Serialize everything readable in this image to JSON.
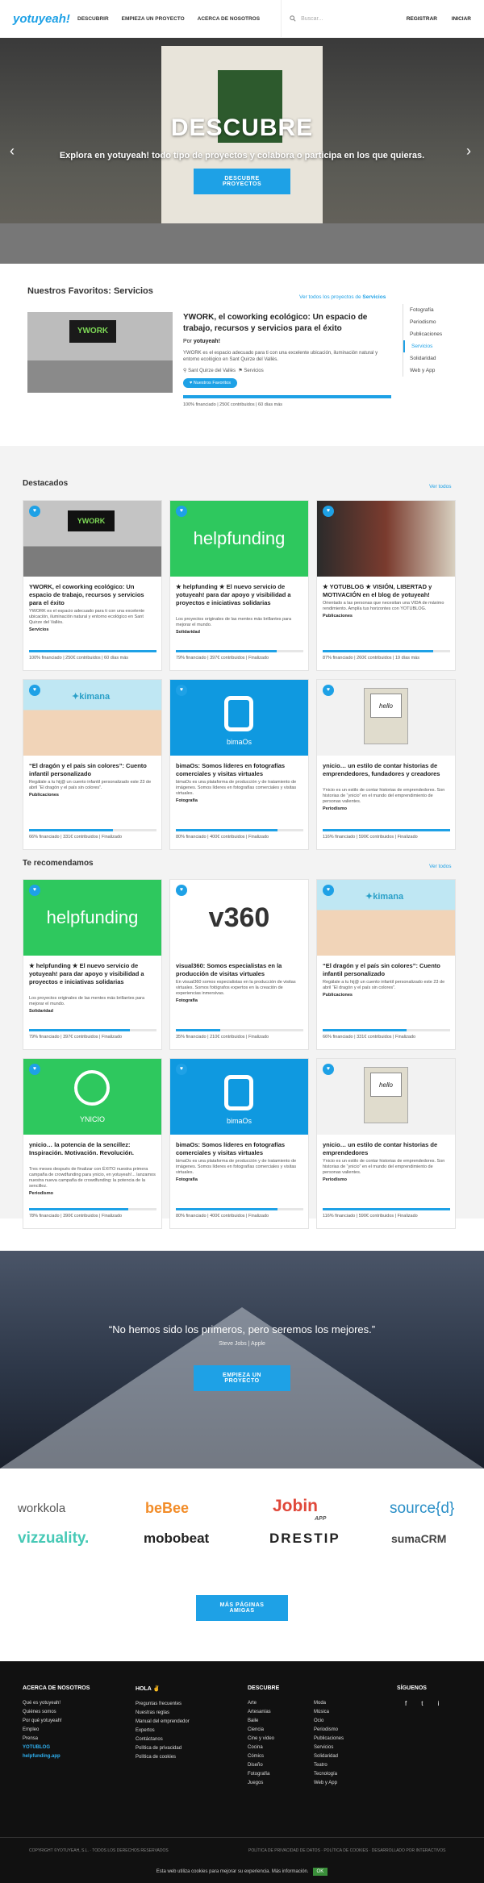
{
  "nav": {
    "logo": "yotuyeah!",
    "links": [
      "DESCUBRIR",
      "EMPIEZA UN PROYECTO",
      "ACERCA DE NOSOTROS"
    ],
    "search_placeholder": "Buscar...",
    "register": "REGISTRAR",
    "login": "INICIAR"
  },
  "hero": {
    "title": "DESCUBRE",
    "subtitle": "Explora en yotuyeah! todo tipo de proyectos y colabora o participa en los que quieras.",
    "button": "DESCUBRE PROYECTOS"
  },
  "favorites": {
    "heading": "Nuestros Favoritos: Servicios",
    "see_all_prefix": "Ver todos los proyectos de ",
    "see_all_cat": "Servicios",
    "title": "YWORK, el coworking ecológico: Un espacio de trabajo, recursos y servicios para el éxito",
    "by": "Por ",
    "author": "yotuyeah!",
    "desc": "YWORK es el espacio adecuado para ti con una excelente ubicación, iluminación natural y entorno ecológico en Sant Quirze del Vallès.",
    "location": "Sant Quirze del Vallès",
    "category": "Servicios",
    "badge": "Nuestros Favoritos",
    "stats": "100% financiado | 250€ contribuidos | 60 días más",
    "progress": 100,
    "side": [
      "Fotografía",
      "Periodismo",
      "Publicaciones",
      "Servicios",
      "Solidaridad",
      "Web y App"
    ]
  },
  "highlighted": {
    "title": "Destacados",
    "see_all": "Ver todos",
    "cards": [
      {
        "title": "YWORK, el coworking ecológico: Un espacio de trabajo, recursos y servicios para el éxito",
        "desc": "YWORK es el espacio adecuado para ti con una excelente ubicación, iluminación natural y entorno ecológico en Sant Quirze del Vallès.",
        "cat": "Servicios",
        "stats": "100% financiado | 250€ contribuidos | 60 días más",
        "progress": 100,
        "img": "ywork"
      },
      {
        "title": "★ helpfunding ★ El nuevo servicio de yotuyeah! para dar apoyo y visibilidad a proyectos e iniciativas solidarias",
        "desc": "Los proyectos originales de las mentes más brillantes para mejorar el mundo.",
        "cat": "Solidaridad",
        "stats": "79% financiado | 397€ contribuidos | Finalizado",
        "progress": 79,
        "img": "helpfunding"
      },
      {
        "title": "★ YOTUBLOG ★ VISIÓN, LIBERTAD y MOTIVACIÓN en el blog de yotuyeah!",
        "desc": "Orientado a las personas que necesitan una VIDA de máximo rendimiento. Amplía tus horizontes con YOTUBLOG.",
        "cat": "Publicaciones",
        "stats": "87% financiado | 260€ contribuidos | 19 días más",
        "progress": 87,
        "img": "mag"
      },
      {
        "title": "“El dragón y el país sin colores”: Cuento infantil personalizado",
        "desc": "Regálale a tu hij@ un cuento infantil personalizado este 23 de abril “El dragón y el país sin colores”.",
        "cat": "Publicaciones",
        "stats": "66% financiado | 331€ contribuidos | Finalizado",
        "progress": 66,
        "img": "kimana"
      },
      {
        "title": "bimaOs: Somos líderes en fotografías comerciales y visitas virtuales",
        "desc": "bimaOs es una plataforma de producción y de tratamiento de imágenes. Somos líderes en fotografías comerciales y visitas virtuales.",
        "cat": "Fotografía",
        "stats": "80% financiado | 400€ contribuidos | Finalizado",
        "progress": 80,
        "img": "bimaos"
      },
      {
        "title": "ynicio… un estilo de contar historias de emprendedores, fundadores y creadores",
        "desc": "Ynicio es un estilo de contar historias de emprendedores. Son historias de “ynicio” en el mundo del emprendimiento de personas valientes.",
        "cat": "Periodismo",
        "stats": "116% financiado | 590€ contribuidos | Finalizado",
        "progress": 100,
        "img": "mac"
      }
    ]
  },
  "recommended": {
    "title": "Te recomendamos",
    "see_all": "Ver todos",
    "cards": [
      {
        "title": "★ helpfunding ★ El nuevo servicio de yotuyeah! para dar apoyo y visibilidad a proyectos e iniciativas solidarias",
        "desc": "Los proyectos originales de las mentes más brillantes para mejorar el mundo.",
        "cat": "Solidaridad",
        "stats": "79% financiado | 397€ contribuidos | Finalizado",
        "progress": 79,
        "img": "helpfunding"
      },
      {
        "title": "visual360: Somos especialistas en la producción de visitas virtuales",
        "desc": "En visual360 somos especialistas en la producción de visitas virtuales. Somos fotógrafos expertos en la creación de experiencias inmersivas.",
        "cat": "Fotografía",
        "stats": "35% financiado | 210€ contribuidos | Finalizado",
        "progress": 35,
        "img": "v360"
      },
      {
        "title": "“El dragón y el país sin colores”: Cuento infantil personalizado",
        "desc": "Regálale a tu hij@ un cuento infantil personalizado este 23 de abril “El dragón y el país sin colores”.",
        "cat": "Publicaciones",
        "stats": "66% financiado | 331€ contribuidos | Finalizado",
        "progress": 66,
        "img": "kimana"
      },
      {
        "title": "ynicio… la potencia de la sencillez: Inspiración. Motivación. Revolución.",
        "desc": "Tres meses después de finalizar con ÉXITO nuestra primera campaña de crowdfunding para ynicio, en yotuyeah!... lanzamos nuestra nueva campaña de crowdfunding: la potencia de la sencillez.",
        "cat": "Periodismo",
        "stats": "78% financiado | 390€ contribuidos | Finalizado",
        "progress": 78,
        "img": "ynicio"
      },
      {
        "title": "bimaOs: Somos líderes en fotografías comerciales y visitas virtuales",
        "desc": "bimaOs es una plataforma de producción y de tratamiento de imágenes. Somos líderes en fotografías comerciales y visitas virtuales.",
        "cat": "Fotografía",
        "stats": "80% financiado | 400€ contribuidos | Finalizado",
        "progress": 80,
        "img": "bimaos"
      },
      {
        "title": "ynicio… un estilo de contar historias de emprendedores",
        "desc": "Ynicio es un estilo de contar historias de emprendedores. Son historias de “ynicio” en el mundo del emprendimiento de personas valientes.",
        "cat": "Periodismo",
        "stats": "116% financiado | 590€ contribuidos | Finalizado",
        "progress": 100,
        "img": "mac"
      }
    ]
  },
  "quote": {
    "text": "“No hemos sido los primeros, pero seremos los mejores.”",
    "author": "Steve Jobs | Apple",
    "button": "EMPIEZA UN PROYECTO"
  },
  "brands": [
    "workkola",
    "beBee",
    "Jobin",
    "source{d}",
    "vizzuality.",
    "mobobeat",
    "DRESTIP",
    "sumaCRM"
  ],
  "brand_sub": "APP",
  "more_button": "MÁS PÁGINAS AMIGAS",
  "footer": {
    "about": {
      "title": "ACERCA DE NOSOTROS",
      "items": [
        "Qué es yotuyeah!",
        "Quiénes somos",
        "Por qué yotuyeah!",
        "Empleo",
        "Prensa",
        "YOTUBLOG",
        "helpfunding.app"
      ]
    },
    "hola": {
      "title": "HOLA ✌",
      "items": [
        "Preguntas frecuentes",
        "Nuestras reglas",
        "Manual del emprendedor",
        "Expertos",
        "Contáctanos",
        "Política de privacidad",
        "Política de cookies"
      ]
    },
    "discover": {
      "title": "DESCUBRE",
      "col1": [
        "Arte",
        "Artesanías",
        "Baile",
        "Ciencia",
        "Cine y video",
        "Cocina",
        "Cómics",
        "Diseño",
        "Fotografía",
        "Juegos"
      ],
      "col2": [
        "Moda",
        "Música",
        "Ocio",
        "Periodismo",
        "Publicaciones",
        "Servicios",
        "Solidaridad",
        "Teatro",
        "Tecnología",
        "Web y App"
      ]
    },
    "follow": {
      "title": "SÍGUENOS",
      "icons": [
        "f",
        "t",
        "i"
      ]
    },
    "copyright": "COPYRIGHT ©YOTUYEAH, S.L. · TODOS LOS DERECHOS RESERVADOS",
    "legal": "POLÍTICA DE PRIVACIDAD DE DATOS · POLÍTICA DE COOKIES · DESARROLLADO POR INTERACTIVOS",
    "cookie": "Esta web utiliza cookies para mejorar su experiencia. Más información.",
    "cookie_ok": "OK"
  },
  "colors": {
    "accent": "#1ea1e6",
    "helpfunding": "#2ec85e",
    "bimaos": "#0f99e0"
  }
}
